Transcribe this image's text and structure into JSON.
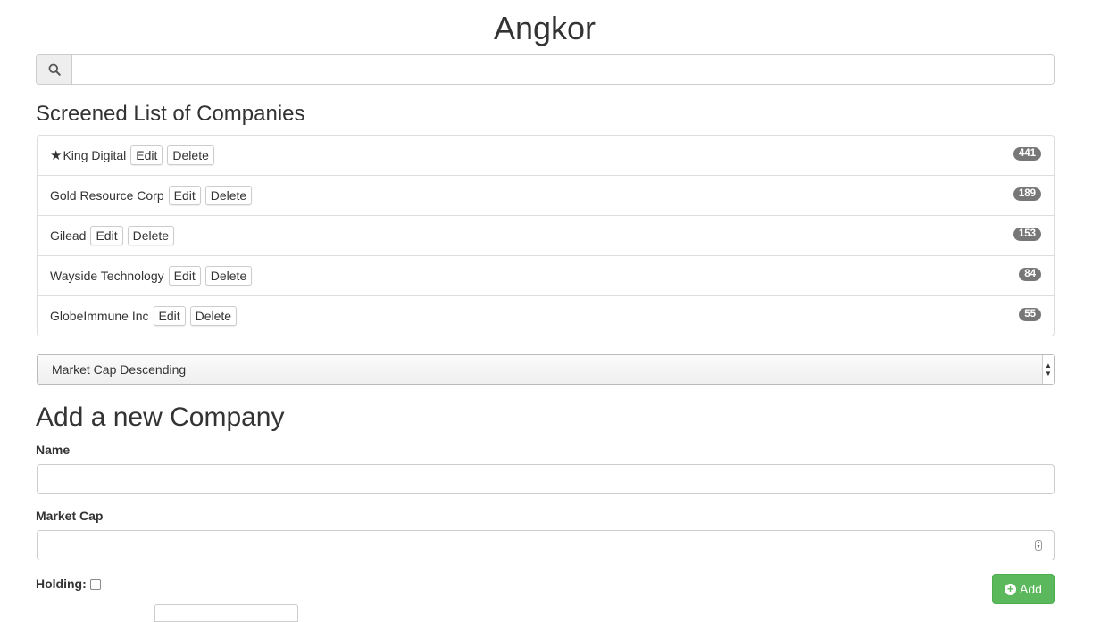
{
  "app": {
    "title": "Angkor"
  },
  "search": {
    "placeholder": "",
    "value": ""
  },
  "list": {
    "heading": "Screened List of Companies",
    "items": [
      {
        "star": "★",
        "name": "King Digital",
        "edit_label": "Edit",
        "delete_label": "Delete",
        "count": "441"
      },
      {
        "star": "",
        "name": "Gold Resource Corp",
        "edit_label": "Edit",
        "delete_label": "Delete",
        "count": "189"
      },
      {
        "star": "",
        "name": "Gilead",
        "edit_label": "Edit",
        "delete_label": "Delete",
        "count": "153"
      },
      {
        "star": "",
        "name": "Wayside Technology",
        "edit_label": "Edit",
        "delete_label": "Delete",
        "count": "84"
      },
      {
        "star": "",
        "name": "GlobeImmune Inc",
        "edit_label": "Edit",
        "delete_label": "Delete",
        "count": "55"
      }
    ]
  },
  "sort": {
    "selected": "Market Cap Descending"
  },
  "form": {
    "heading": "Add a new Company",
    "name_label": "Name",
    "name_value": "",
    "market_cap_label": "Market Cap",
    "market_cap_value": "",
    "holding_label": "Holding:",
    "holding_checked": false,
    "add_label": "Add"
  },
  "colors": {
    "success": "#5cb85c",
    "badge": "#777777",
    "border": "#dddddd"
  }
}
